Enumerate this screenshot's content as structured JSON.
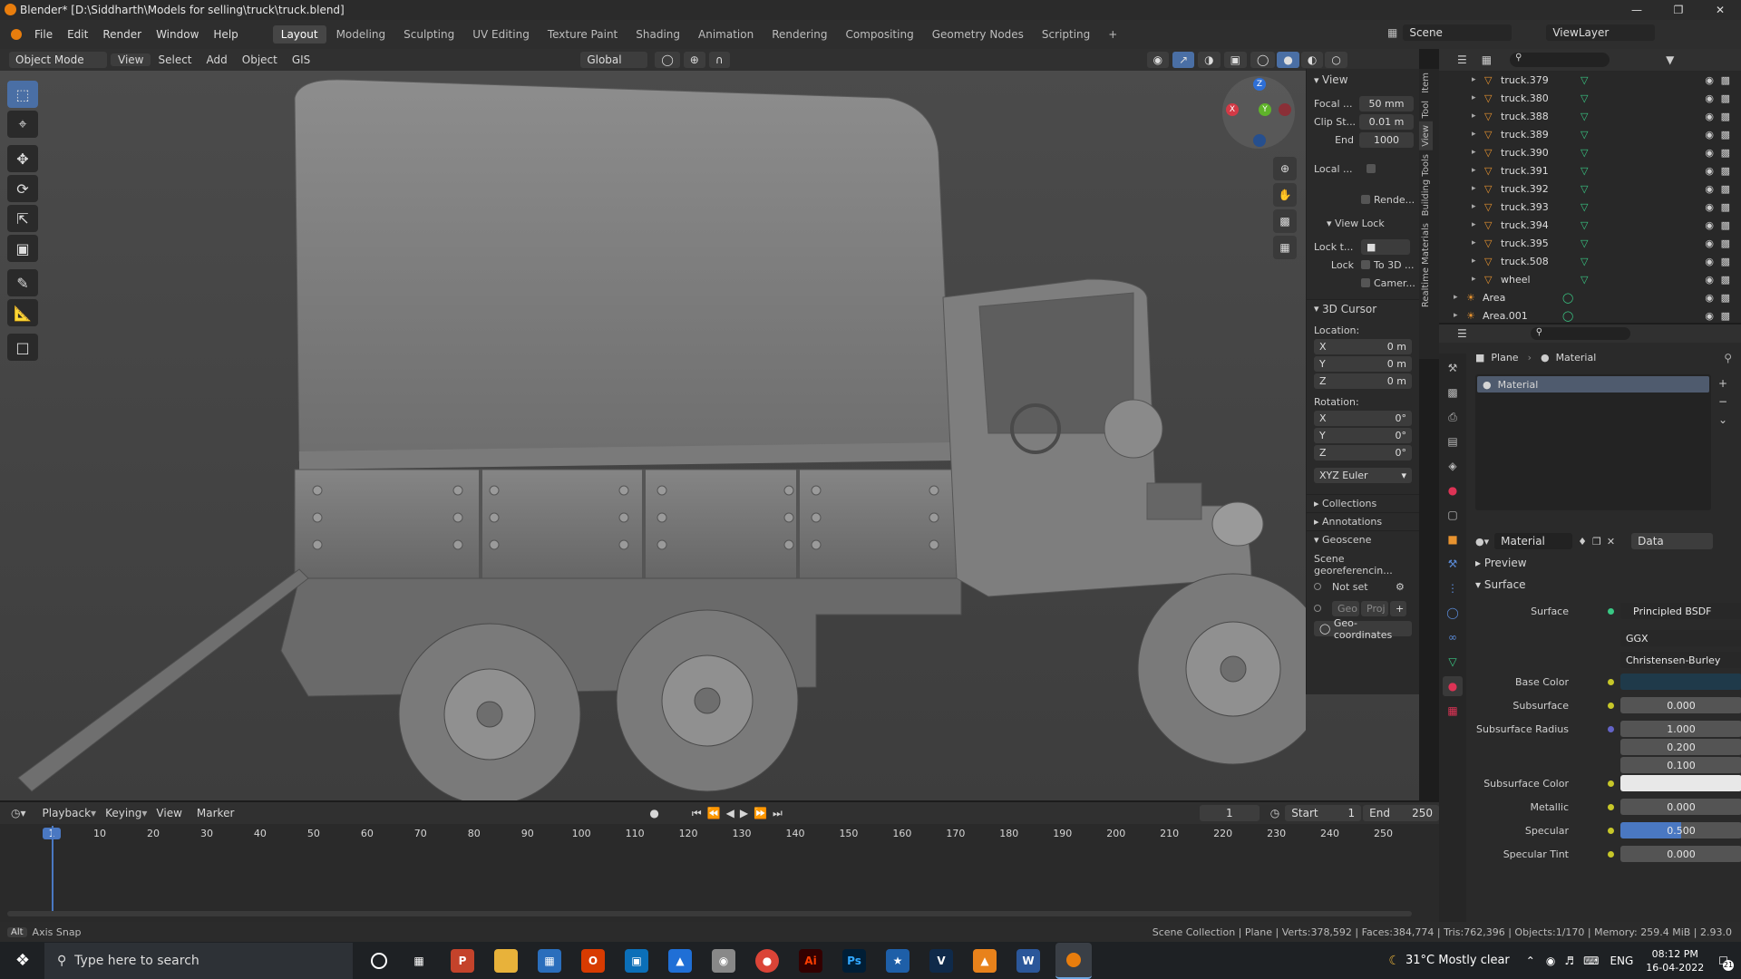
{
  "window": {
    "title": "Blender* [D:\\Siddharth\\Models for selling\\truck\\truck.blend]"
  },
  "menu": {
    "items": [
      "File",
      "Edit",
      "Render",
      "Window",
      "Help"
    ]
  },
  "workspaces": [
    "Layout",
    "Modeling",
    "Sculpting",
    "UV Editing",
    "Texture Paint",
    "Shading",
    "Animation",
    "Rendering",
    "Compositing",
    "Geometry Nodes",
    "Scripting"
  ],
  "top_right": {
    "scene": "Scene",
    "view_layer": "ViewLayer"
  },
  "viewport_header": {
    "mode": "Object Mode",
    "menus": [
      "View",
      "Select",
      "Add",
      "Object",
      "GIS"
    ],
    "transform": "Global"
  },
  "npanel": {
    "view_title": "View",
    "focal_label": "Focal ...",
    "focal": "50 mm",
    "clip_start_label": "Clip St...",
    "clip_start": "0.01 m",
    "clip_end_label": "End",
    "clip_end": "1000",
    "local_label": "Local ...",
    "render_label": "Rende...",
    "view_lock": "View Lock",
    "lock_to_label": "Lock t...",
    "lock_label": "Lock",
    "to_3d": "To 3D ...",
    "camera": "Camer...",
    "cursor_title": "3D Cursor",
    "location_label": "Location:",
    "loc": [
      {
        "axis": "X",
        "value": "0 m"
      },
      {
        "axis": "Y",
        "value": "0 m"
      },
      {
        "axis": "Z",
        "value": "0 m"
      }
    ],
    "rotation_label": "Rotation:",
    "rot": [
      {
        "axis": "X",
        "value": "0°"
      },
      {
        "axis": "Y",
        "value": "0°"
      },
      {
        "axis": "Z",
        "value": "0°"
      }
    ],
    "euler": "XYZ Euler",
    "collections": "Collections",
    "annotations": "Annotations",
    "geoscene": "Geoscene",
    "georef": "Scene georeferencin...",
    "not_set": "Not set",
    "geo": "Geo",
    "proj": "Proj",
    "geocoords": "Geo-coordinates"
  },
  "side_tabs": [
    "Item",
    "Tool",
    "View",
    "Building Tools",
    "Realtime Materials"
  ],
  "outliner": {
    "rows": [
      {
        "name": "truck.379",
        "kind": "mesh"
      },
      {
        "name": "truck.380",
        "kind": "mesh"
      },
      {
        "name": "truck.388",
        "kind": "mesh"
      },
      {
        "name": "truck.389",
        "kind": "mesh"
      },
      {
        "name": "truck.390",
        "kind": "mesh"
      },
      {
        "name": "truck.391",
        "kind": "mesh"
      },
      {
        "name": "truck.392",
        "kind": "mesh"
      },
      {
        "name": "truck.393",
        "kind": "mesh"
      },
      {
        "name": "truck.394",
        "kind": "mesh"
      },
      {
        "name": "truck.395",
        "kind": "mesh"
      },
      {
        "name": "truck.508",
        "kind": "mesh"
      },
      {
        "name": "wheel",
        "kind": "mesh"
      },
      {
        "name": "Area",
        "kind": "light"
      },
      {
        "name": "Area.001",
        "kind": "light"
      }
    ]
  },
  "properties": {
    "breadcrumb_object": "Plane",
    "breadcrumb_material": "Material",
    "slot": "Material",
    "material_name": "Material",
    "data_select": "Data",
    "preview": "Preview",
    "surface_section": "Surface",
    "surface_label": "Surface",
    "surface_value": "Principled BSDF",
    "distribution": "GGX",
    "subsurface_method": "Christensen-Burley",
    "fields": [
      {
        "label": "Base Color",
        "value": "",
        "kind": "color",
        "color": "#1f3a4a"
      },
      {
        "label": "Subsurface",
        "value": "0.000",
        "kind": "num"
      },
      {
        "label": "Subsurface Radius",
        "value": "1.000",
        "kind": "num"
      },
      {
        "label": "",
        "value": "0.200",
        "kind": "num"
      },
      {
        "label": "",
        "value": "0.100",
        "kind": "num"
      },
      {
        "label": "Subsurface Color",
        "value": "",
        "kind": "color",
        "color": "#e8e8e8"
      },
      {
        "label": "Metallic",
        "value": "0.000",
        "kind": "num"
      },
      {
        "label": "Specular",
        "value": "0.500",
        "kind": "slider",
        "fraction": 0.5
      },
      {
        "label": "Specular Tint",
        "value": "0.000",
        "kind": "num"
      }
    ]
  },
  "timeline": {
    "menus": [
      "Playback",
      "Keying",
      "View",
      "Marker"
    ],
    "current_frame": "1",
    "start_label": "Start",
    "start": "1",
    "end_label": "End",
    "end": "250",
    "ticks": [
      "1",
      "10",
      "20",
      "30",
      "40",
      "50",
      "60",
      "70",
      "80",
      "90",
      "100",
      "110",
      "120",
      "130",
      "140",
      "150",
      "160",
      "170",
      "180",
      "190",
      "200",
      "210",
      "220",
      "230",
      "240",
      "250"
    ]
  },
  "status": {
    "left": "Axis Snap",
    "key": "Alt",
    "right": "Scene Collection | Plane | Verts:378,592 | Faces:384,774 | Tris:762,396 | Objects:1/170 | Memory: 259.4 MiB | 2.93.0"
  },
  "taskbar": {
    "search": "Type here to search",
    "weather": "31°C  Mostly clear",
    "lang": "ENG",
    "time": "08:12 PM",
    "date": "16-04-2022",
    "notif": "21"
  },
  "colors": {
    "accent": "#4a6fa5",
    "header": "#303030",
    "panel": "#2a2a2a"
  }
}
